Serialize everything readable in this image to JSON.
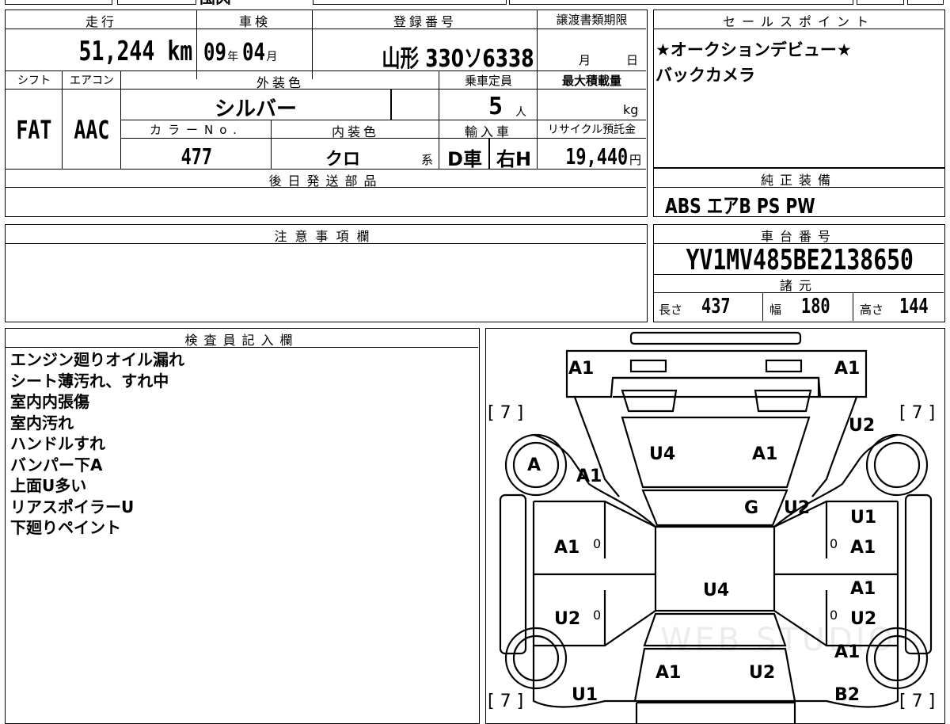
{
  "top_partial": "国内",
  "header_row1": {
    "mileage_label": "走行",
    "inspection_label": "車検",
    "registration_label": "登録番号",
    "transfer_label": "譲渡書類期限",
    "sales_point_label": "セールスポイント"
  },
  "mileage": "51,244",
  "mileage_unit": "km",
  "inspection": {
    "year": "09",
    "year_unit": "年",
    "month": "04",
    "month_unit": "月"
  },
  "registration_number": "山形 330ソ6338",
  "transfer_deadline": {
    "month_unit": "月",
    "day_unit": "日"
  },
  "sales_points": [
    "★オークションデビュー★",
    "バックカメラ"
  ],
  "header_row2": {
    "shift_label": "シフト",
    "ac_label": "エアコン",
    "exterior_label": "外装色",
    "capacity_label": "乗車定員",
    "max_load_label": "最大積載量"
  },
  "shift": "FAT",
  "ac": "AAC",
  "exterior_color": "シルバー",
  "capacity": "5",
  "capacity_unit": "人",
  "max_load_unit": "kg",
  "header_row3": {
    "color_no_label": "カラーNo.",
    "interior_label": "内装色",
    "import_label": "輸入車",
    "recycle_label": "リサイクル預託金"
  },
  "color_no": "477",
  "interior_color": "クロ",
  "interior_suffix": "系",
  "import_type": "D車",
  "steering": "右H",
  "recycle_fee": "19,440",
  "recycle_unit": "円",
  "later_parts_label": "後日発送部品",
  "equipment_label": "純正装備",
  "equipment": "ABS エアB PS PW",
  "notes_label": "注意事項欄",
  "chassis_label": "車台番号",
  "chassis_number": "YV1MV485BE2138650",
  "specs_label": "諸元",
  "specs": {
    "length_label": "長さ",
    "length": "437",
    "width_label": "幅",
    "width": "180",
    "height_label": "高さ",
    "height": "144"
  },
  "inspector_label": "検査員記入欄",
  "inspector_notes": [
    "エンジン廻りオイル漏れ",
    "シート薄汚れ、すれ中",
    "室内内張傷",
    "室内汚れ",
    "ハンドルすれ",
    "バンパー下A",
    "上面U多い",
    "リアスポイラーU",
    "下廻りペイント"
  ],
  "diagram": {
    "tire_marks": [
      "[ 7 ]",
      "[ 7 ]",
      "[ 7 ]",
      "[ 7 ]"
    ],
    "zero_marks": [
      "0",
      "0",
      "0",
      "0"
    ],
    "damage_labels": [
      "A1",
      "A1",
      "U2",
      "A",
      "A1",
      "U4",
      "A1",
      "G",
      "U2",
      "U1",
      "A1",
      "A1",
      "A1",
      "U4",
      "A1",
      "U2",
      "U2",
      "A1",
      "A1",
      "U2",
      "U1",
      "B2"
    ]
  },
  "watermark": "WEB STUDIO"
}
